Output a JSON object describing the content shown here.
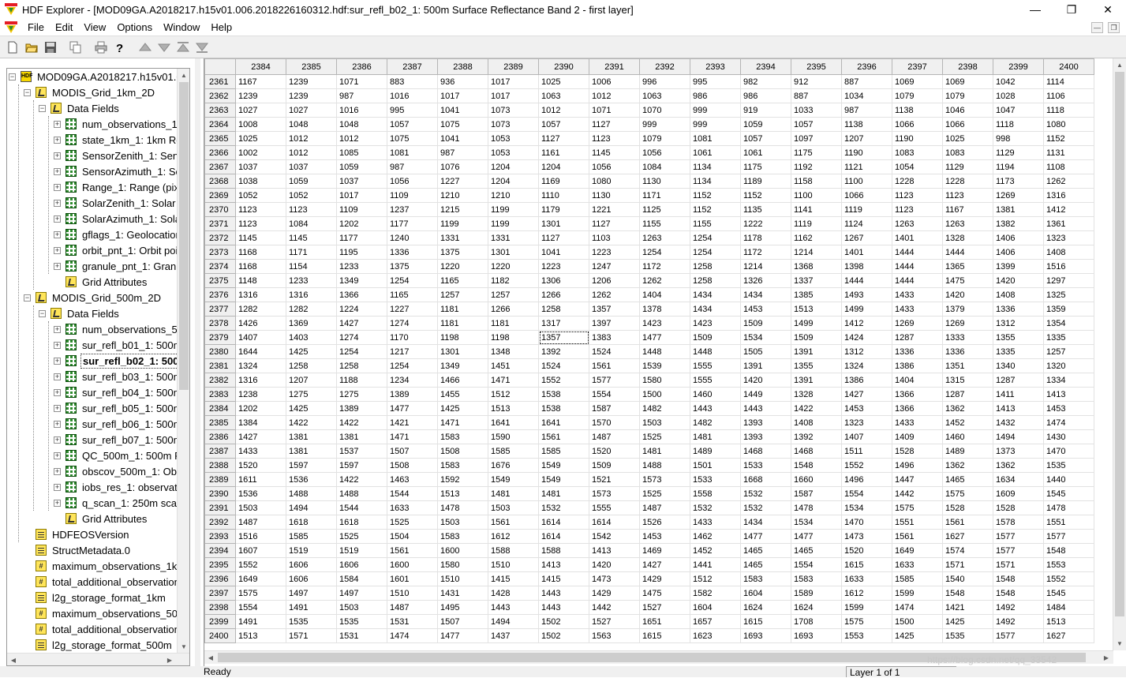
{
  "window": {
    "title": "HDF Explorer - [MOD09GA.A2018217.h15v01.006.2018226160312.hdf:sur_refl_b02_1: 500m Surface Reflectance Band 2 - first layer]",
    "minimize_icon": "minimize-icon",
    "restore_icon": "restore-icon",
    "close_icon": "close-icon"
  },
  "menu": [
    "File",
    "Edit",
    "View",
    "Options",
    "Window",
    "Help"
  ],
  "toolbar": {
    "buttons": [
      "new-file-icon",
      "open-folder-icon",
      "save-icon",
      "copy-icon",
      "print-icon",
      "help-icon",
      "move-up-icon",
      "move-down-icon",
      "first-icon",
      "last-icon"
    ]
  },
  "tree": {
    "file": "MOD09GA.A2018217.h15v01.006.2018226160312.hdf",
    "grid1": "MODIS_Grid_1km_2D",
    "grid1_fields_label": "Data Fields",
    "grid1_fields": [
      "num_observations_1km",
      "state_1km_1: 1km Reflectance Data State QA",
      "SensorZenith_1: Sensor zenith",
      "SensorAzimuth_1: Sensor azimuth",
      "Range_1: Range (pixel to sensor)",
      "SolarZenith_1: Solar zenith",
      "SolarAzimuth_1: Solar azimuth",
      "gflags_1: Geolocation flags",
      "orbit_pnt_1: Orbit pointer",
      "granule_pnt_1: Granule pointer"
    ],
    "grid1_attr": "Grid Attributes",
    "grid2": "MODIS_Grid_500m_2D",
    "grid2_fields_label": "Data Fields",
    "grid2_fields": [
      "num_observations_500m",
      "sur_refl_b01_1: 500m Surface Reflectance Band 1",
      "sur_refl_b02_1: 500m Surface Reflectance Band 2",
      "sur_refl_b03_1: 500m Surface Reflectance Band 3",
      "sur_refl_b04_1: 500m Surface Reflectance Band 4",
      "sur_refl_b05_1: 500m Surface Reflectance Band 5",
      "sur_refl_b06_1: 500m Surface Reflectance Band 6",
      "sur_refl_b07_1: 500m Surface Reflectance Band 7",
      "QC_500m_1: 500m Reflectance Band Quality",
      "obscov_500m_1: Observation coverage",
      "iobs_res_1: observation number",
      "q_scan_1: 250m scan value information"
    ],
    "grid2_attr": "Grid Attributes",
    "file_attrs": [
      "HDFEOSVersion",
      "StructMetadata.0",
      "maximum_observations_1km",
      "total_additional_observations_1km",
      "l2g_storage_format_1km",
      "maximum_observations_500m",
      "total_additional_observations_500m",
      "l2g_storage_format_500m"
    ],
    "selected": "sur_refl_b02_1: 500m Surface Reflectance Band 2"
  },
  "grid": {
    "columns": [
      "2384",
      "2385",
      "2386",
      "2387",
      "2388",
      "2389",
      "2390",
      "2391",
      "2392",
      "2393",
      "2394",
      "2395",
      "2396",
      "2397",
      "2398",
      "2399",
      "2400"
    ],
    "rows": [
      [
        "2361",
        "1167",
        "1239",
        "1071",
        "883",
        "936",
        "1017",
        "1025",
        "1006",
        "996",
        "995",
        "982",
        "912",
        "887",
        "1069",
        "1069",
        "1042",
        "1114"
      ],
      [
        "2362",
        "1239",
        "1239",
        "987",
        "1016",
        "1017",
        "1017",
        "1063",
        "1012",
        "1063",
        "986",
        "986",
        "887",
        "1034",
        "1079",
        "1079",
        "1028",
        "1106"
      ],
      [
        "2363",
        "1027",
        "1027",
        "1016",
        "995",
        "1041",
        "1073",
        "1012",
        "1071",
        "1070",
        "999",
        "919",
        "1033",
        "987",
        "1138",
        "1046",
        "1047",
        "1118"
      ],
      [
        "2364",
        "1008",
        "1048",
        "1048",
        "1057",
        "1075",
        "1073",
        "1057",
        "1127",
        "999",
        "999",
        "1059",
        "1057",
        "1138",
        "1066",
        "1066",
        "1118",
        "1080"
      ],
      [
        "2365",
        "1025",
        "1012",
        "1012",
        "1075",
        "1041",
        "1053",
        "1127",
        "1123",
        "1079",
        "1081",
        "1057",
        "1097",
        "1207",
        "1190",
        "1025",
        "998",
        "1152"
      ],
      [
        "2366",
        "1002",
        "1012",
        "1085",
        "1081",
        "987",
        "1053",
        "1161",
        "1145",
        "1056",
        "1061",
        "1061",
        "1175",
        "1190",
        "1083",
        "1083",
        "1129",
        "1131"
      ],
      [
        "2367",
        "1037",
        "1037",
        "1059",
        "987",
        "1076",
        "1204",
        "1204",
        "1056",
        "1084",
        "1134",
        "1175",
        "1192",
        "1121",
        "1054",
        "1129",
        "1194",
        "1108"
      ],
      [
        "2368",
        "1038",
        "1059",
        "1037",
        "1056",
        "1227",
        "1204",
        "1169",
        "1080",
        "1130",
        "1134",
        "1189",
        "1158",
        "1100",
        "1228",
        "1228",
        "1173",
        "1262"
      ],
      [
        "2369",
        "1052",
        "1052",
        "1017",
        "1109",
        "1210",
        "1210",
        "1110",
        "1130",
        "1171",
        "1152",
        "1152",
        "1100",
        "1066",
        "1123",
        "1123",
        "1269",
        "1316"
      ],
      [
        "2370",
        "1123",
        "1123",
        "1109",
        "1237",
        "1215",
        "1199",
        "1179",
        "1221",
        "1125",
        "1152",
        "1135",
        "1141",
        "1119",
        "1123",
        "1167",
        "1381",
        "1412"
      ],
      [
        "2371",
        "1123",
        "1084",
        "1202",
        "1177",
        "1199",
        "1199",
        "1301",
        "1127",
        "1155",
        "1155",
        "1222",
        "1119",
        "1124",
        "1263",
        "1263",
        "1382",
        "1361"
      ],
      [
        "2372",
        "1145",
        "1145",
        "1177",
        "1240",
        "1331",
        "1331",
        "1127",
        "1103",
        "1263",
        "1254",
        "1178",
        "1162",
        "1267",
        "1401",
        "1328",
        "1406",
        "1323"
      ],
      [
        "2373",
        "1168",
        "1171",
        "1195",
        "1336",
        "1375",
        "1301",
        "1041",
        "1223",
        "1254",
        "1254",
        "1172",
        "1214",
        "1401",
        "1444",
        "1444",
        "1406",
        "1408"
      ],
      [
        "2374",
        "1168",
        "1154",
        "1233",
        "1375",
        "1220",
        "1220",
        "1223",
        "1247",
        "1172",
        "1258",
        "1214",
        "1368",
        "1398",
        "1444",
        "1365",
        "1399",
        "1516"
      ],
      [
        "2375",
        "1148",
        "1233",
        "1349",
        "1254",
        "1165",
        "1182",
        "1306",
        "1206",
        "1262",
        "1258",
        "1326",
        "1337",
        "1444",
        "1444",
        "1475",
        "1420",
        "1297"
      ],
      [
        "2376",
        "1316",
        "1316",
        "1366",
        "1165",
        "1257",
        "1257",
        "1266",
        "1262",
        "1404",
        "1434",
        "1434",
        "1385",
        "1493",
        "1433",
        "1420",
        "1408",
        "1325"
      ],
      [
        "2377",
        "1282",
        "1282",
        "1224",
        "1227",
        "1181",
        "1266",
        "1258",
        "1357",
        "1378",
        "1434",
        "1453",
        "1513",
        "1499",
        "1433",
        "1379",
        "1336",
        "1359"
      ],
      [
        "2378",
        "1426",
        "1369",
        "1427",
        "1274",
        "1181",
        "1181",
        "1317",
        "1397",
        "1423",
        "1423",
        "1509",
        "1499",
        "1412",
        "1269",
        "1269",
        "1312",
        "1354"
      ],
      [
        "2379",
        "1407",
        "1403",
        "1274",
        "1170",
        "1198",
        "1198",
        "1357",
        "1383",
        "1477",
        "1509",
        "1534",
        "1509",
        "1424",
        "1287",
        "1333",
        "1355",
        "1335"
      ],
      [
        "2380",
        "1644",
        "1425",
        "1254",
        "1217",
        "1301",
        "1348",
        "1392",
        "1524",
        "1448",
        "1448",
        "1505",
        "1391",
        "1312",
        "1336",
        "1336",
        "1335",
        "1257"
      ],
      [
        "2381",
        "1324",
        "1258",
        "1258",
        "1254",
        "1349",
        "1451",
        "1524",
        "1561",
        "1539",
        "1555",
        "1391",
        "1355",
        "1324",
        "1386",
        "1351",
        "1340",
        "1320"
      ],
      [
        "2382",
        "1316",
        "1207",
        "1188",
        "1234",
        "1466",
        "1471",
        "1552",
        "1577",
        "1580",
        "1555",
        "1420",
        "1391",
        "1386",
        "1404",
        "1315",
        "1287",
        "1334"
      ],
      [
        "2383",
        "1238",
        "1275",
        "1275",
        "1389",
        "1455",
        "1512",
        "1538",
        "1554",
        "1500",
        "1460",
        "1449",
        "1328",
        "1427",
        "1366",
        "1287",
        "1411",
        "1413"
      ],
      [
        "2384",
        "1202",
        "1425",
        "1389",
        "1477",
        "1425",
        "1513",
        "1538",
        "1587",
        "1482",
        "1443",
        "1443",
        "1422",
        "1453",
        "1366",
        "1362",
        "1413",
        "1453"
      ],
      [
        "2385",
        "1384",
        "1422",
        "1422",
        "1421",
        "1471",
        "1641",
        "1641",
        "1570",
        "1503",
        "1482",
        "1393",
        "1408",
        "1323",
        "1433",
        "1452",
        "1432",
        "1474"
      ],
      [
        "2386",
        "1427",
        "1381",
        "1381",
        "1471",
        "1583",
        "1590",
        "1561",
        "1487",
        "1525",
        "1481",
        "1393",
        "1392",
        "1407",
        "1409",
        "1460",
        "1494",
        "1430"
      ],
      [
        "2387",
        "1433",
        "1381",
        "1537",
        "1507",
        "1508",
        "1585",
        "1585",
        "1520",
        "1481",
        "1489",
        "1468",
        "1468",
        "1511",
        "1528",
        "1489",
        "1373",
        "1470"
      ],
      [
        "2388",
        "1520",
        "1597",
        "1597",
        "1508",
        "1583",
        "1676",
        "1549",
        "1509",
        "1488",
        "1501",
        "1533",
        "1548",
        "1552",
        "1496",
        "1362",
        "1362",
        "1535"
      ],
      [
        "2389",
        "1611",
        "1536",
        "1422",
        "1463",
        "1592",
        "1549",
        "1549",
        "1521",
        "1573",
        "1533",
        "1668",
        "1660",
        "1496",
        "1447",
        "1465",
        "1634",
        "1440"
      ],
      [
        "2390",
        "1536",
        "1488",
        "1488",
        "1544",
        "1513",
        "1481",
        "1481",
        "1573",
        "1525",
        "1558",
        "1532",
        "1587",
        "1554",
        "1442",
        "1575",
        "1609",
        "1545"
      ],
      [
        "2391",
        "1503",
        "1494",
        "1544",
        "1633",
        "1478",
        "1503",
        "1532",
        "1555",
        "1487",
        "1532",
        "1532",
        "1478",
        "1534",
        "1575",
        "1528",
        "1528",
        "1478"
      ],
      [
        "2392",
        "1487",
        "1618",
        "1618",
        "1525",
        "1503",
        "1561",
        "1614",
        "1614",
        "1526",
        "1433",
        "1434",
        "1534",
        "1470",
        "1551",
        "1561",
        "1578",
        "1551"
      ],
      [
        "2393",
        "1516",
        "1585",
        "1525",
        "1504",
        "1583",
        "1612",
        "1614",
        "1542",
        "1453",
        "1462",
        "1477",
        "1477",
        "1473",
        "1561",
        "1627",
        "1577",
        "1577"
      ],
      [
        "2394",
        "1607",
        "1519",
        "1519",
        "1561",
        "1600",
        "1588",
        "1588",
        "1413",
        "1469",
        "1452",
        "1465",
        "1465",
        "1520",
        "1649",
        "1574",
        "1577",
        "1548"
      ],
      [
        "2395",
        "1552",
        "1606",
        "1606",
        "1600",
        "1580",
        "1510",
        "1413",
        "1420",
        "1427",
        "1441",
        "1465",
        "1554",
        "1615",
        "1633",
        "1571",
        "1571",
        "1553"
      ],
      [
        "2396",
        "1649",
        "1606",
        "1584",
        "1601",
        "1510",
        "1415",
        "1415",
        "1473",
        "1429",
        "1512",
        "1583",
        "1583",
        "1633",
        "1585",
        "1540",
        "1548",
        "1552"
      ],
      [
        "2397",
        "1575",
        "1497",
        "1497",
        "1510",
        "1431",
        "1428",
        "1443",
        "1429",
        "1475",
        "1582",
        "1604",
        "1589",
        "1612",
        "1599",
        "1548",
        "1548",
        "1545"
      ],
      [
        "2398",
        "1554",
        "1491",
        "1503",
        "1487",
        "1495",
        "1443",
        "1443",
        "1442",
        "1527",
        "1604",
        "1624",
        "1624",
        "1599",
        "1474",
        "1421",
        "1492",
        "1484"
      ],
      [
        "2399",
        "1491",
        "1535",
        "1535",
        "1531",
        "1507",
        "1494",
        "1502",
        "1527",
        "1651",
        "1657",
        "1615",
        "1708",
        "1575",
        "1500",
        "1425",
        "1492",
        "1513"
      ],
      [
        "2400",
        "1513",
        "1571",
        "1531",
        "1474",
        "1477",
        "1437",
        "1502",
        "1563",
        "1615",
        "1623",
        "1693",
        "1693",
        "1553",
        "1425",
        "1535",
        "1577",
        "1627"
      ]
    ],
    "current_cell": {
      "row": 18,
      "col": 7
    }
  },
  "status": {
    "left": "Ready",
    "right": "Layer 1 of 1"
  },
  "watermark": "https://blog.csdn.net/qq_33542"
}
